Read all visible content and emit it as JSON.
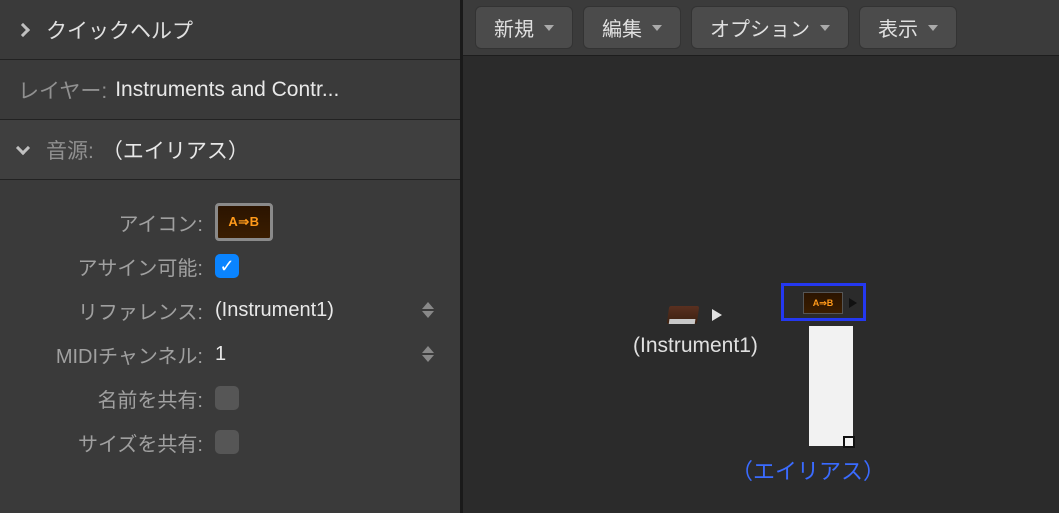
{
  "left": {
    "quick_help_title": "クイックヘルプ",
    "layer_label": "レイヤー:",
    "layer_value": "Instruments and Contr...",
    "instrument_section_label": "音源:",
    "instrument_section_value": "（エイリアス）",
    "properties": {
      "icon_label": "アイコン:",
      "icon_text": "A⇒B",
      "assignable_label": "アサイン可能:",
      "assignable_checked": true,
      "reference_label": "リファレンス:",
      "reference_value": "(Instrument1)",
      "midi_channel_label": "MIDIチャンネル:",
      "midi_channel_value": "1",
      "share_name_label": "名前を共有:",
      "share_name_checked": false,
      "share_size_label": "サイズを共有:",
      "share_size_checked": false
    }
  },
  "toolbar": {
    "new_label": "新規",
    "edit_label": "編集",
    "option_label": "オプション",
    "view_label": "表示"
  },
  "canvas": {
    "instrument_label": "(Instrument1)",
    "alias_icon_text": "A⇒B",
    "alias_label": "（エイリアス）"
  }
}
